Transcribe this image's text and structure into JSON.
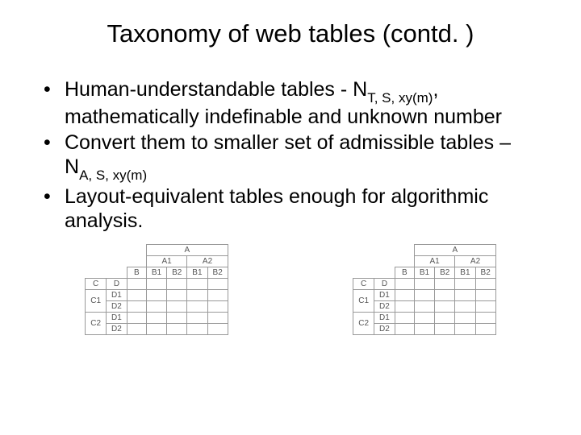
{
  "title": "Taxonomy of web tables (contd. )",
  "bullets": [
    {
      "pre": "Human-understandable tables - N",
      "sub": "T, S, xy(m)",
      "post": ", mathematically indefinable and unknown number"
    },
    {
      "pre": "Convert them to smaller set of admissible tables – N",
      "sub": "A, S, xy(m)",
      "post": ""
    },
    {
      "pre": "Layout-equivalent tables enough for algorithmic analysis.",
      "sub": "",
      "post": ""
    }
  ],
  "fig1": {
    "top1": "A",
    "a_cols": [
      "A1",
      "A2"
    ],
    "b_row": [
      "B",
      "B1",
      "B2",
      "B1",
      "B2"
    ],
    "side_top": [
      "C",
      "D"
    ],
    "rows": [
      {
        "c": "C1",
        "d": "D1"
      },
      {
        "c": "",
        "d": "D2"
      },
      {
        "c": "C2",
        "d": "D1"
      },
      {
        "c": "",
        "d": "D2"
      }
    ]
  },
  "fig2": {
    "top1": "A",
    "a_cols": [
      "A1",
      "A2"
    ],
    "b_row": [
      "B",
      "B1",
      "B2",
      "B1",
      "B2"
    ],
    "side_top": [
      "C",
      "D"
    ],
    "rows": [
      {
        "c": "C1",
        "d": "D1"
      },
      {
        "c": "",
        "d": "D2"
      },
      {
        "c": "C2",
        "d": "D1"
      },
      {
        "c": "",
        "d": "D2"
      }
    ]
  }
}
